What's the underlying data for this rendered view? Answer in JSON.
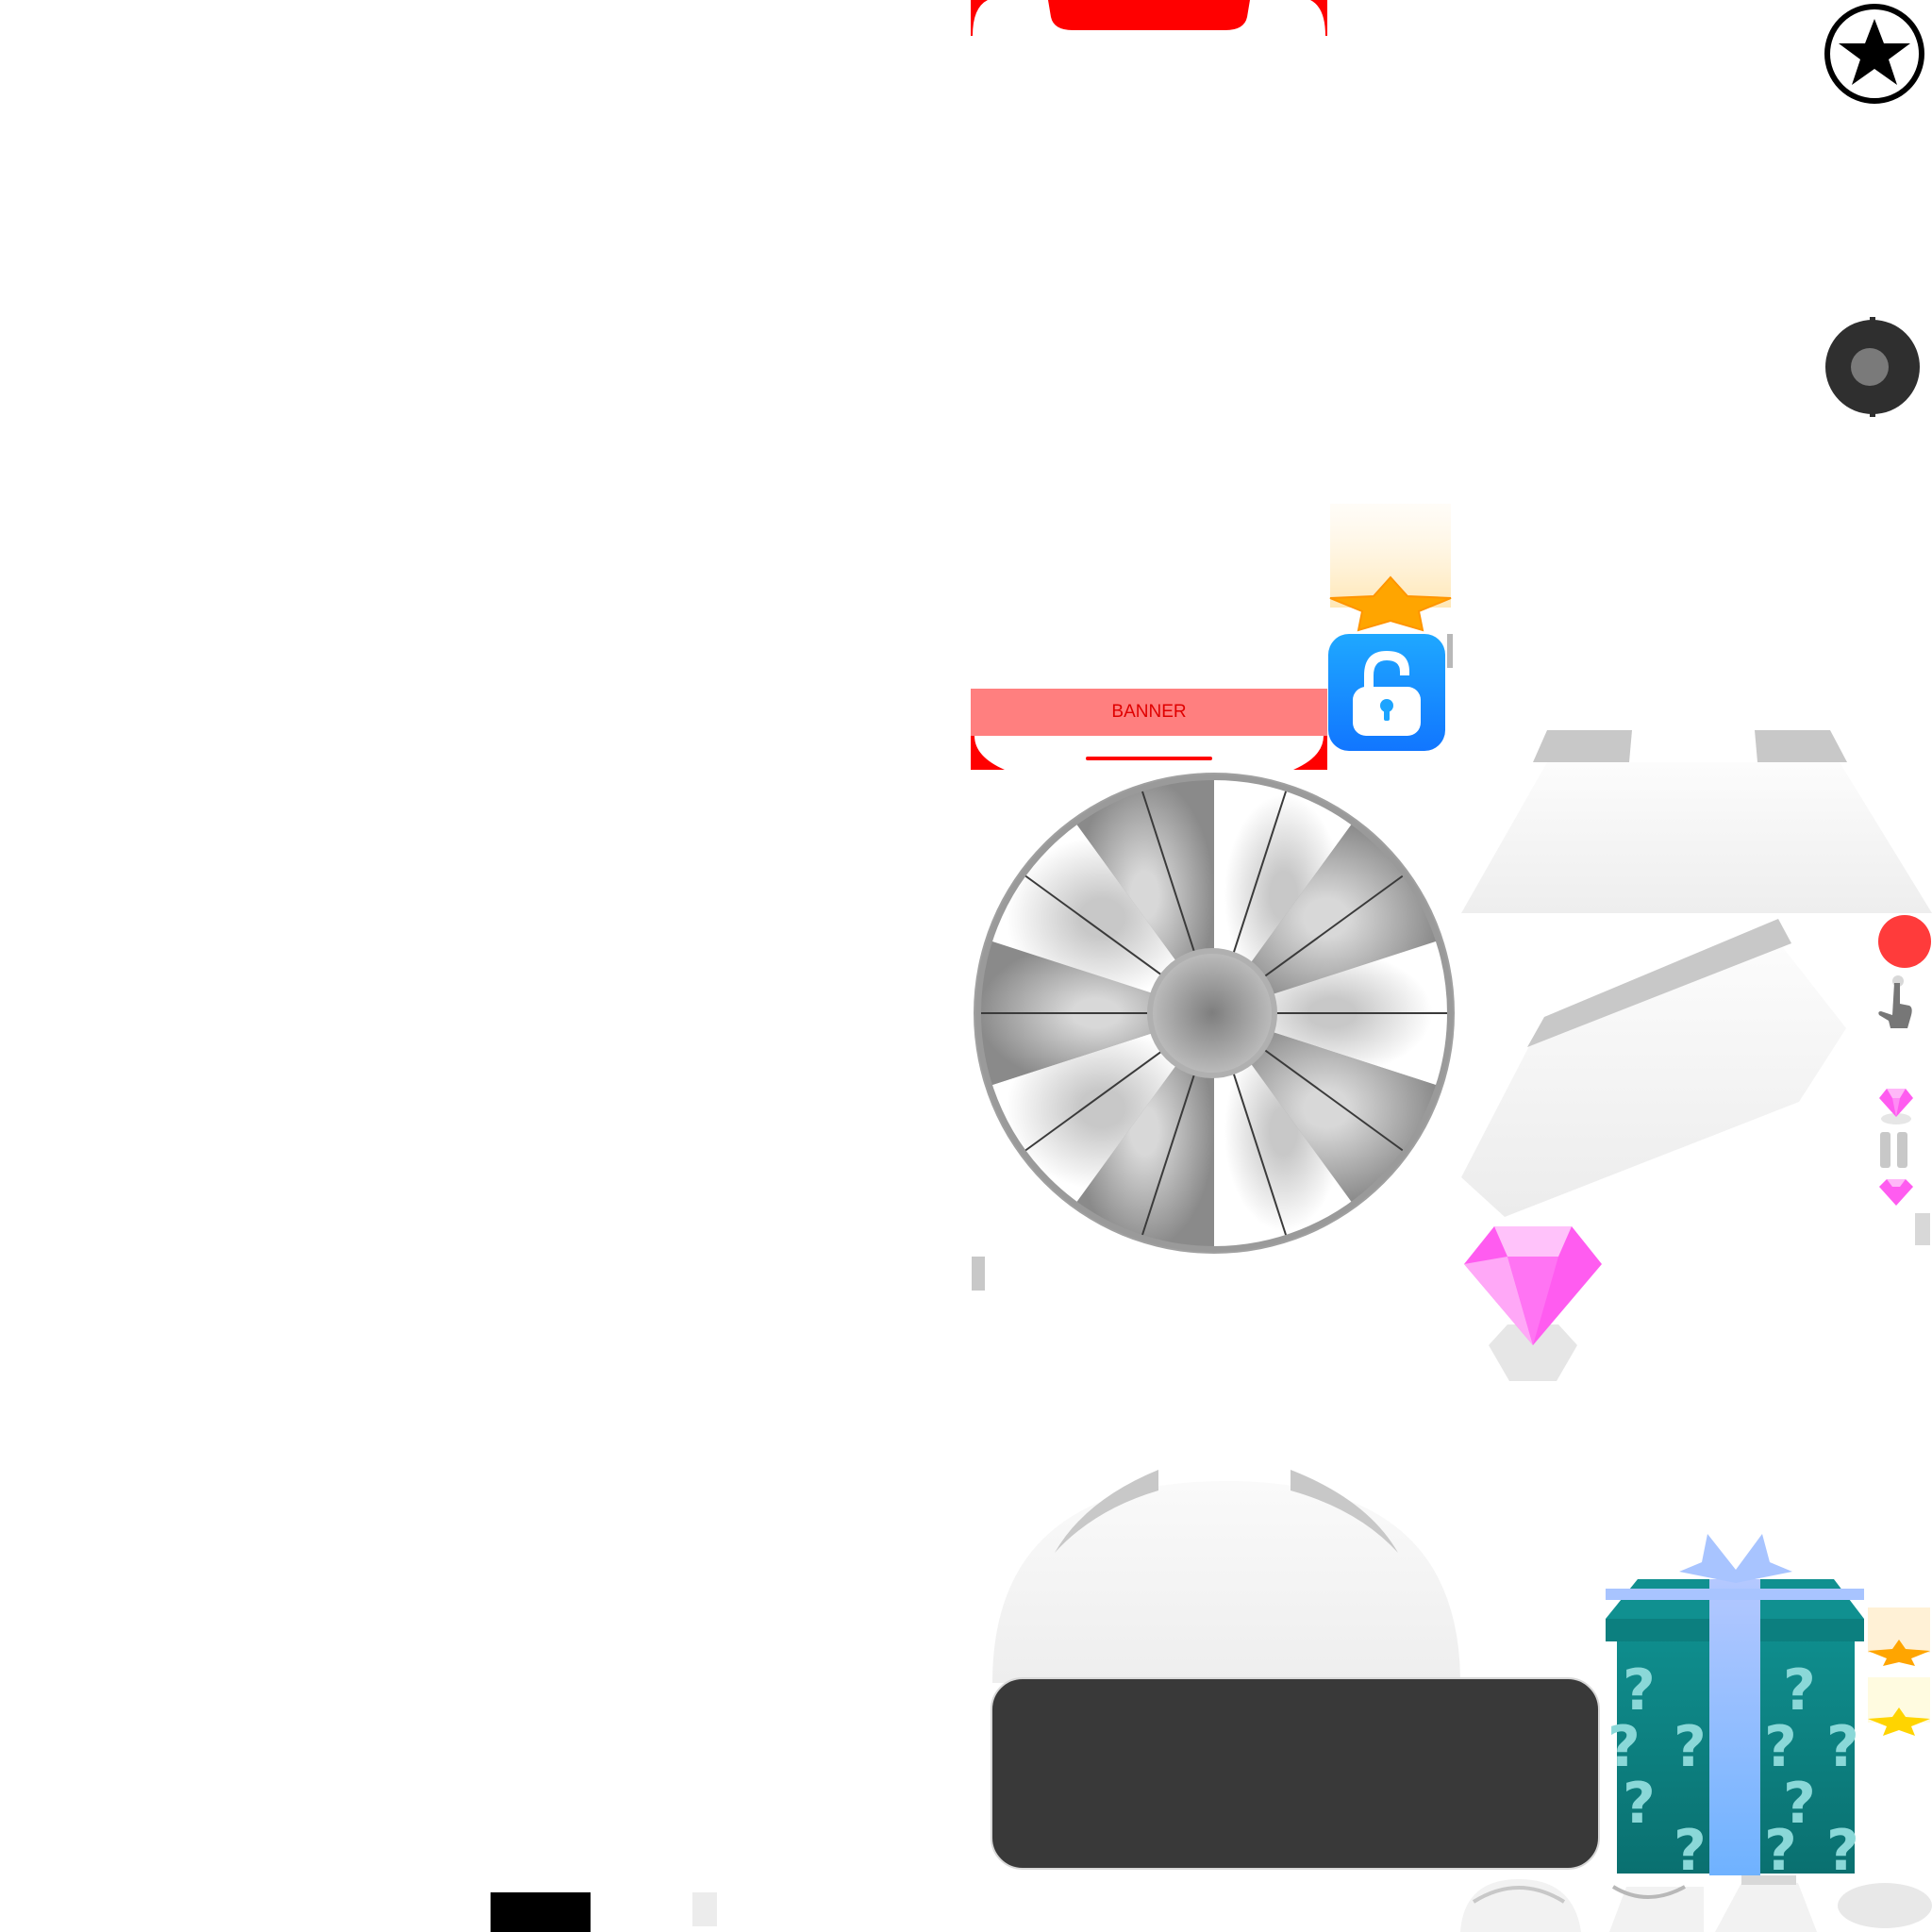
{
  "sheet": {
    "banner_label": "BANNER"
  },
  "icons": {
    "star_badge": "star-circle-icon",
    "joystick": "joystick-icon",
    "lock": "unlock-icon",
    "star": "star-icon",
    "gem": "gem-icon",
    "gift": "gift-box-icon",
    "hand": "pointer-hand-icon",
    "pause": "pause-icon"
  },
  "colors": {
    "red": "#ff0000",
    "banner_fill": "#ff7f7f",
    "lock_blue": "#1e90ff",
    "star_orange": "#ffa500",
    "star_yellow": "#ffd400",
    "gem_pink": "#ff5cf0",
    "gift_teal": "#0f8f8f",
    "ribbon_blue": "#8ab8ff",
    "panel_dark": "#393939",
    "wheel_gray": "#a8a8a8"
  }
}
